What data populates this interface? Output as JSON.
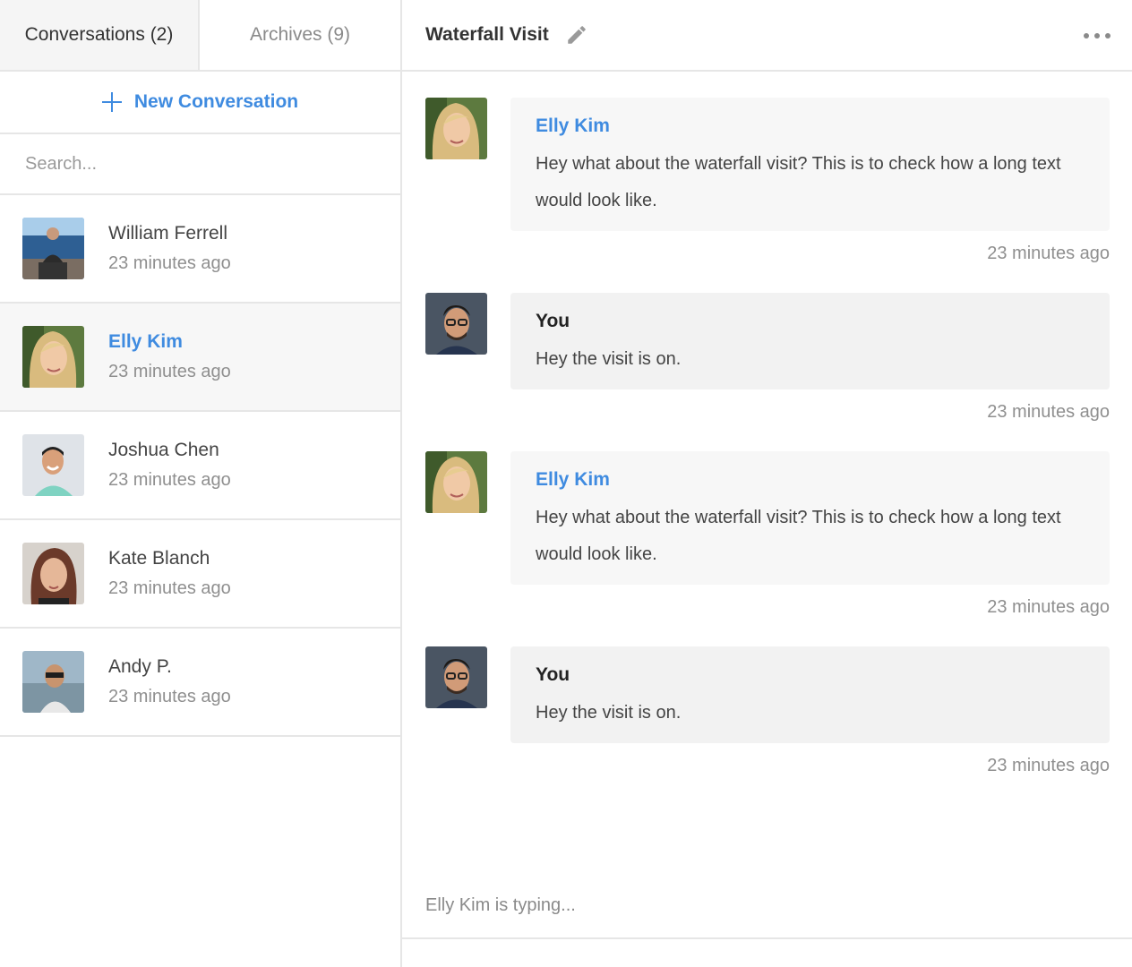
{
  "sidebar": {
    "tabs": [
      {
        "label": "Conversations (2)"
      },
      {
        "label": "Archives (9)"
      }
    ],
    "new_conversation_label": "New Conversation",
    "search_placeholder": "Search...",
    "contacts": [
      {
        "name": "William Ferrell",
        "time": "23 minutes ago"
      },
      {
        "name": "Elly Kim",
        "time": "23 minutes ago"
      },
      {
        "name": "Joshua Chen",
        "time": "23 minutes ago"
      },
      {
        "name": "Kate Blanch",
        "time": "23 minutes ago"
      },
      {
        "name": "Andy P.",
        "time": "23 minutes ago"
      }
    ]
  },
  "chat": {
    "title": "Waterfall Visit",
    "messages": [
      {
        "sender": "Elly Kim",
        "text": "Hey what about the waterfall visit? This is to check how a long text would look like.",
        "time": "23 minutes ago"
      },
      {
        "sender": "You",
        "text": "Hey the visit is on.",
        "time": "23 minutes ago"
      },
      {
        "sender": "Elly Kim",
        "text": "Hey what about the waterfall visit? This is to check how a long text would look like.",
        "time": "23 minutes ago"
      },
      {
        "sender": "You",
        "text": "Hey the visit is on.",
        "time": "23 minutes ago"
      }
    ],
    "typing_indicator": "Elly Kim is typing..."
  },
  "colors": {
    "accent": "#3f8be0",
    "border": "#e6e6e6",
    "bubble_other": "#f7f7f7",
    "bubble_me": "#f2f2f2"
  }
}
